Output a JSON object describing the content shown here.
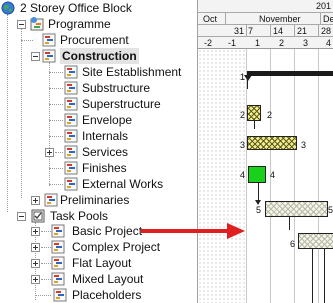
{
  "tree": {
    "root": {
      "label": "2 Storey Office Block",
      "icon": "globe-icon"
    },
    "programme": {
      "label": "Programme",
      "icon": "programme-icon"
    },
    "procurement": {
      "label": "Procurement",
      "icon": "gantt-doc-icon"
    },
    "construction": {
      "label": "Construction",
      "icon": "gantt-doc-icon"
    },
    "construction_children": [
      {
        "label": "Site Establishment"
      },
      {
        "label": "Substructure"
      },
      {
        "label": "Superstructure"
      },
      {
        "label": "Envelope"
      },
      {
        "label": "Internals"
      },
      {
        "label": "Services"
      },
      {
        "label": "Finishes"
      },
      {
        "label": "External Works"
      }
    ],
    "preliminaries": {
      "label": "Preliminaries",
      "icon": "gantt-doc-icon"
    },
    "task_pools": {
      "label": "Task Pools",
      "icon": "task-pool-icon"
    },
    "task_pool_children": [
      {
        "label": "Basic Project"
      },
      {
        "label": "Complex Project"
      },
      {
        "label": "Flat Layout"
      },
      {
        "label": "Mixed Layout"
      },
      {
        "label": "Placeholders"
      }
    ]
  },
  "gantt": {
    "year": "201",
    "months": [
      "Oct",
      "November",
      "Dec"
    ],
    "weeks": [
      "31",
      "7",
      "14",
      "21",
      "28"
    ],
    "week_offsets": [
      "-2",
      "-1",
      "1",
      "2",
      "3",
      "4"
    ],
    "task_numbers": [
      "1",
      "2",
      "2",
      "3",
      "3",
      "4",
      "4",
      "5",
      "5",
      "6"
    ],
    "colors": {
      "hatch": "#f2ec8c",
      "green": "#19d11b",
      "arrow": "#e02020"
    }
  }
}
